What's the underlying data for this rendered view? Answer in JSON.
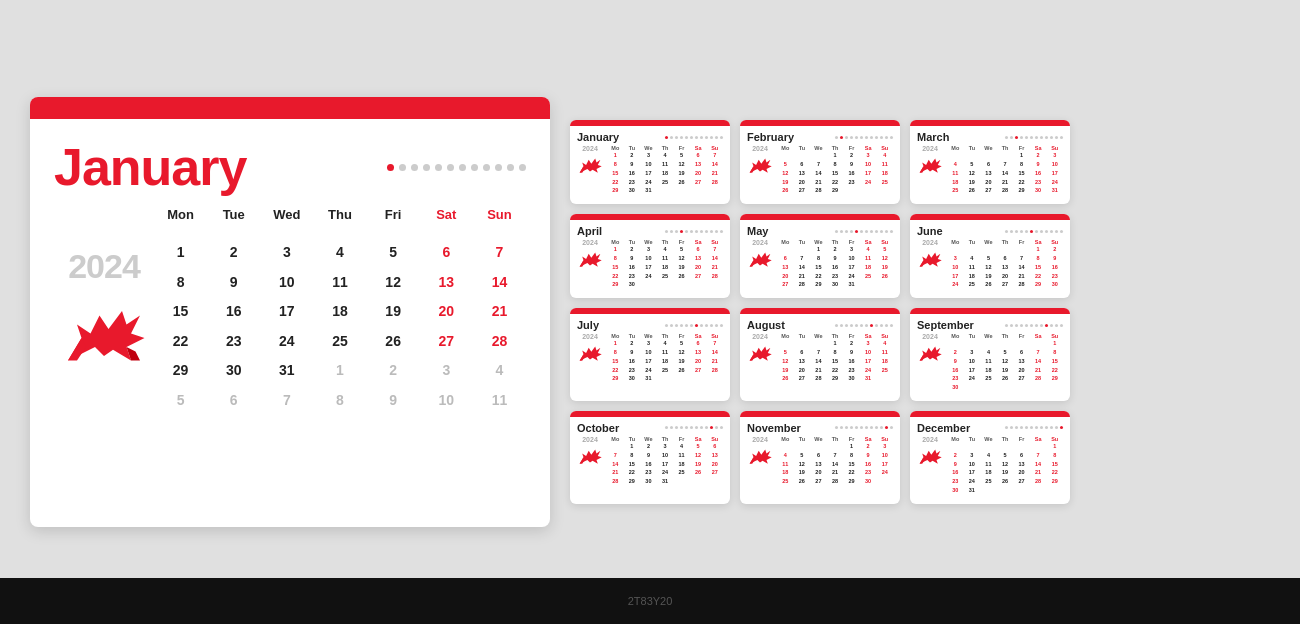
{
  "large": {
    "month": "January",
    "year": "2024",
    "redBar": true,
    "dots": [
      true,
      false,
      false,
      false,
      false,
      false,
      false,
      false,
      false,
      false,
      false,
      false
    ],
    "headers": [
      "Mon",
      "Tue",
      "Wed",
      "Thu",
      "Fri",
      "Sat",
      "Sun"
    ],
    "headersRed": [
      false,
      false,
      false,
      false,
      false,
      true,
      true
    ],
    "weeks": [
      [
        "",
        "",
        "",
        "",
        "",
        "",
        ""
      ],
      [
        "1",
        "2",
        "3",
        "4",
        "5",
        "6",
        "7"
      ],
      [
        "8",
        "9",
        "10",
        "11",
        "12",
        "13",
        "14"
      ],
      [
        "15",
        "16",
        "17",
        "18",
        "19",
        "20",
        "21"
      ],
      [
        "22",
        "23",
        "24",
        "25",
        "26",
        "27",
        "28"
      ],
      [
        "29",
        "30",
        "31",
        "1",
        "2",
        "3",
        "4"
      ],
      [
        "5",
        "6",
        "7",
        "8",
        "9",
        "10",
        "11"
      ]
    ],
    "weeksRed": [
      [
        false,
        false,
        false,
        false,
        false,
        false,
        false
      ],
      [
        false,
        false,
        false,
        false,
        false,
        true,
        true
      ],
      [
        false,
        false,
        false,
        false,
        false,
        true,
        true
      ],
      [
        false,
        false,
        false,
        false,
        false,
        true,
        true
      ],
      [
        false,
        false,
        false,
        false,
        false,
        true,
        true
      ],
      [
        false,
        false,
        false,
        true,
        true,
        true,
        true
      ],
      [
        true,
        true,
        true,
        true,
        true,
        true,
        true
      ]
    ],
    "weeksGray": [
      [
        false,
        false,
        false,
        false,
        false,
        false,
        false
      ],
      [
        false,
        false,
        false,
        false,
        false,
        false,
        false
      ],
      [
        false,
        false,
        false,
        false,
        false,
        false,
        false
      ],
      [
        false,
        false,
        false,
        false,
        false,
        false,
        false
      ],
      [
        false,
        false,
        false,
        false,
        false,
        false,
        false
      ],
      [
        false,
        false,
        false,
        true,
        true,
        true,
        true
      ],
      [
        true,
        true,
        true,
        true,
        true,
        true,
        true
      ]
    ]
  },
  "months": [
    {
      "name": "January",
      "rows": [
        [
          "",
          "",
          "",
          "",
          "",
          "",
          ""
        ],
        [
          "1",
          "2",
          "3",
          "4",
          "5",
          "6",
          "7"
        ],
        [
          "8",
          "9",
          "10",
          "11",
          "12",
          "13",
          "14"
        ],
        [
          "15",
          "16",
          "17",
          "18",
          "19",
          "20",
          "21"
        ],
        [
          "22",
          "23",
          "24",
          "25",
          "26",
          "27",
          "28"
        ],
        [
          "29",
          "30",
          "31",
          "",
          "",
          "",
          ""
        ]
      ],
      "reds": [
        [
          0,
          0,
          0,
          0,
          0,
          5,
          6
        ],
        [
          0,
          0,
          0,
          0,
          0,
          5,
          6
        ],
        [
          0,
          0,
          0,
          0,
          0,
          5,
          6
        ],
        [
          0,
          0,
          0,
          0,
          0,
          5,
          6
        ],
        [
          0,
          0,
          0,
          0,
          0,
          5,
          6
        ],
        [
          0,
          0,
          0,
          0,
          0,
          0,
          0
        ]
      ]
    },
    {
      "name": "February",
      "rows": [
        [
          "",
          "",
          "",
          "1",
          "2",
          "3",
          "4"
        ],
        [
          "5",
          "6",
          "7",
          "8",
          "9",
          "10",
          "11"
        ],
        [
          "12",
          "13",
          "14",
          "15",
          "16",
          "17",
          "18"
        ],
        [
          "19",
          "20",
          "21",
          "22",
          "23",
          "24",
          "25"
        ],
        [
          "26",
          "27",
          "28",
          "29",
          "",
          "",
          ""
        ]
      ],
      "reds": [
        [
          0,
          0,
          0,
          0,
          0,
          5,
          6
        ],
        [
          0,
          0,
          0,
          0,
          0,
          5,
          6
        ],
        [
          0,
          0,
          0,
          0,
          0,
          5,
          6
        ],
        [
          0,
          0,
          0,
          0,
          0,
          5,
          6
        ],
        [
          0,
          0,
          0,
          0,
          0,
          0,
          0
        ]
      ]
    },
    {
      "name": "March",
      "rows": [
        [
          "",
          "",
          "",
          "",
          "1",
          "2",
          "3"
        ],
        [
          "4",
          "5",
          "6",
          "7",
          "8",
          "9",
          "10"
        ],
        [
          "11",
          "12",
          "13",
          "14",
          "15",
          "16",
          "17"
        ],
        [
          "18",
          "19",
          "20",
          "21",
          "22",
          "23",
          "24"
        ],
        [
          "25",
          "26",
          "27",
          "28",
          "29",
          "30",
          "31"
        ]
      ],
      "reds": [
        [
          0,
          0,
          0,
          0,
          0,
          5,
          6
        ],
        [
          0,
          0,
          0,
          0,
          0,
          5,
          6
        ],
        [
          0,
          0,
          0,
          0,
          0,
          5,
          6
        ],
        [
          0,
          0,
          0,
          0,
          0,
          5,
          6
        ],
        [
          0,
          0,
          0,
          0,
          0,
          5,
          6
        ]
      ]
    },
    {
      "name": "April",
      "rows": [
        [
          "1",
          "2",
          "3",
          "4",
          "5",
          "6",
          "7"
        ],
        [
          "8",
          "9",
          "10",
          "11",
          "12",
          "13",
          "14"
        ],
        [
          "15",
          "16",
          "17",
          "18",
          "19",
          "20",
          "21"
        ],
        [
          "22",
          "23",
          "24",
          "25",
          "26",
          "27",
          "28"
        ],
        [
          "29",
          "30",
          "",
          "",
          "",
          "",
          ""
        ]
      ],
      "reds": [
        [
          0,
          0,
          0,
          0,
          0,
          5,
          6
        ],
        [
          0,
          0,
          0,
          0,
          0,
          5,
          6
        ],
        [
          0,
          0,
          0,
          0,
          0,
          5,
          6
        ],
        [
          0,
          0,
          0,
          0,
          0,
          5,
          6
        ],
        [
          0,
          0,
          0,
          0,
          0,
          0,
          0
        ]
      ]
    },
    {
      "name": "May",
      "rows": [
        [
          "",
          "",
          "1",
          "2",
          "3",
          "4",
          "5"
        ],
        [
          "6",
          "7",
          "8",
          "9",
          "10",
          "11",
          "12"
        ],
        [
          "13",
          "14",
          "15",
          "16",
          "17",
          "18",
          "19"
        ],
        [
          "20",
          "21",
          "22",
          "23",
          "24",
          "25",
          "26"
        ],
        [
          "27",
          "28",
          "29",
          "30",
          "31",
          "",
          ""
        ]
      ],
      "reds": [
        [
          0,
          0,
          0,
          0,
          0,
          5,
          6
        ],
        [
          0,
          0,
          0,
          0,
          0,
          5,
          6
        ],
        [
          0,
          0,
          0,
          0,
          0,
          5,
          6
        ],
        [
          0,
          0,
          0,
          0,
          0,
          5,
          6
        ],
        [
          0,
          0,
          0,
          0,
          0,
          0,
          0
        ]
      ]
    },
    {
      "name": "June",
      "rows": [
        [
          "",
          "",
          "",
          "",
          "",
          "1",
          "2"
        ],
        [
          "3",
          "4",
          "5",
          "6",
          "7",
          "8",
          "9"
        ],
        [
          "10",
          "11",
          "12",
          "13",
          "14",
          "15",
          "16"
        ],
        [
          "17",
          "18",
          "19",
          "20",
          "21",
          "22",
          "23"
        ],
        [
          "24",
          "25",
          "26",
          "27",
          "28",
          "29",
          "30"
        ]
      ],
      "reds": [
        [
          0,
          0,
          0,
          0,
          0,
          5,
          6
        ],
        [
          0,
          0,
          0,
          0,
          0,
          5,
          6
        ],
        [
          0,
          0,
          0,
          0,
          0,
          5,
          6
        ],
        [
          0,
          0,
          0,
          0,
          0,
          5,
          6
        ],
        [
          0,
          0,
          0,
          0,
          0,
          5,
          6
        ]
      ]
    },
    {
      "name": "July",
      "rows": [
        [
          "1",
          "2",
          "3",
          "4",
          "5",
          "6",
          "7"
        ],
        [
          "8",
          "9",
          "10",
          "11",
          "12",
          "13",
          "14"
        ],
        [
          "15",
          "16",
          "17",
          "18",
          "19",
          "20",
          "21"
        ],
        [
          "22",
          "23",
          "24",
          "25",
          "26",
          "27",
          "28"
        ],
        [
          "29",
          "30",
          "31",
          "",
          "",
          "",
          ""
        ]
      ],
      "reds": [
        [
          0,
          0,
          0,
          0,
          0,
          5,
          6
        ],
        [
          0,
          0,
          0,
          0,
          0,
          5,
          6
        ],
        [
          0,
          0,
          0,
          0,
          0,
          5,
          6
        ],
        [
          0,
          0,
          0,
          0,
          0,
          5,
          6
        ],
        [
          0,
          0,
          0,
          0,
          0,
          0,
          0
        ]
      ]
    },
    {
      "name": "August",
      "rows": [
        [
          "",
          "",
          "",
          "1",
          "2",
          "3",
          "4"
        ],
        [
          "5",
          "6",
          "7",
          "8",
          "9",
          "10",
          "11"
        ],
        [
          "12",
          "13",
          "14",
          "15",
          "16",
          "17",
          "18"
        ],
        [
          "19",
          "20",
          "21",
          "22",
          "23",
          "24",
          "25"
        ],
        [
          "26",
          "27",
          "28",
          "29",
          "30",
          "31",
          ""
        ]
      ],
      "reds": [
        [
          0,
          0,
          0,
          0,
          0,
          5,
          6
        ],
        [
          0,
          0,
          0,
          0,
          0,
          5,
          6
        ],
        [
          0,
          0,
          0,
          0,
          0,
          5,
          6
        ],
        [
          0,
          0,
          0,
          0,
          0,
          5,
          6
        ],
        [
          0,
          0,
          0,
          0,
          0,
          5,
          6
        ]
      ]
    },
    {
      "name": "September",
      "rows": [
        [
          "",
          "",
          "",
          "",
          "",
          "",
          "1"
        ],
        [
          "2",
          "3",
          "4",
          "5",
          "6",
          "7",
          "8"
        ],
        [
          "9",
          "10",
          "11",
          "12",
          "13",
          "14",
          "15"
        ],
        [
          "16",
          "17",
          "18",
          "19",
          "20",
          "21",
          "22"
        ],
        [
          "23",
          "24",
          "25",
          "26",
          "27",
          "28",
          "29"
        ],
        [
          "30",
          "",
          "",
          "",
          "",
          "",
          ""
        ]
      ],
      "reds": [
        [
          0,
          0,
          0,
          0,
          0,
          0,
          6
        ],
        [
          0,
          0,
          0,
          0,
          0,
          5,
          6
        ],
        [
          0,
          0,
          0,
          0,
          0,
          5,
          6
        ],
        [
          0,
          0,
          0,
          0,
          0,
          5,
          6
        ],
        [
          0,
          0,
          0,
          0,
          0,
          5,
          6
        ],
        [
          0,
          0,
          0,
          0,
          0,
          0,
          0
        ]
      ]
    },
    {
      "name": "October",
      "rows": [
        [
          "",
          "1",
          "2",
          "3",
          "4",
          "5",
          "6"
        ],
        [
          "7",
          "8",
          "9",
          "10",
          "11",
          "12",
          "13"
        ],
        [
          "14",
          "15",
          "16",
          "17",
          "18",
          "19",
          "20"
        ],
        [
          "21",
          "22",
          "23",
          "24",
          "25",
          "26",
          "27"
        ],
        [
          "28",
          "29",
          "30",
          "31",
          "",
          "",
          ""
        ]
      ],
      "reds": [
        [
          0,
          0,
          0,
          0,
          0,
          5,
          6
        ],
        [
          0,
          0,
          0,
          0,
          0,
          5,
          6
        ],
        [
          0,
          0,
          0,
          0,
          0,
          5,
          6
        ],
        [
          0,
          0,
          0,
          0,
          0,
          5,
          6
        ],
        [
          0,
          0,
          0,
          0,
          0,
          0,
          0
        ]
      ]
    },
    {
      "name": "November",
      "rows": [
        [
          "",
          "",
          "",
          "",
          "1",
          "2",
          "3"
        ],
        [
          "4",
          "5",
          "6",
          "7",
          "8",
          "9",
          "10"
        ],
        [
          "11",
          "12",
          "13",
          "14",
          "15",
          "16",
          "17"
        ],
        [
          "18",
          "19",
          "20",
          "21",
          "22",
          "23",
          "24"
        ],
        [
          "25",
          "26",
          "27",
          "28",
          "29",
          "30",
          ""
        ]
      ],
      "reds": [
        [
          0,
          0,
          0,
          0,
          0,
          5,
          6
        ],
        [
          0,
          0,
          0,
          0,
          0,
          5,
          6
        ],
        [
          0,
          0,
          0,
          0,
          0,
          5,
          6
        ],
        [
          0,
          0,
          0,
          0,
          0,
          5,
          6
        ],
        [
          0,
          0,
          0,
          0,
          0,
          5,
          6
        ]
      ]
    },
    {
      "name": "December",
      "rows": [
        [
          "",
          "",
          "",
          "",
          "",
          "",
          "1"
        ],
        [
          "2",
          "3",
          "4",
          "5",
          "6",
          "7",
          "8"
        ],
        [
          "9",
          "10",
          "11",
          "12",
          "13",
          "14",
          "15"
        ],
        [
          "16",
          "17",
          "18",
          "19",
          "20",
          "21",
          "22"
        ],
        [
          "23",
          "24",
          "25",
          "26",
          "27",
          "28",
          "29"
        ],
        [
          "30",
          "31",
          "",
          "",
          "",
          "",
          ""
        ]
      ],
      "reds": [
        [
          0,
          0,
          0,
          0,
          0,
          0,
          6
        ],
        [
          0,
          0,
          0,
          0,
          0,
          5,
          6
        ],
        [
          0,
          0,
          0,
          0,
          0,
          5,
          6
        ],
        [
          0,
          0,
          0,
          0,
          0,
          5,
          6
        ],
        [
          0,
          0,
          0,
          0,
          0,
          5,
          6
        ],
        [
          0,
          0,
          0,
          0,
          0,
          0,
          0
        ]
      ]
    }
  ],
  "headers_small": [
    "Mo",
    "Tu",
    "We",
    "Th",
    "Fr",
    "Sa",
    "Su"
  ],
  "watermark": "2T83Y20"
}
